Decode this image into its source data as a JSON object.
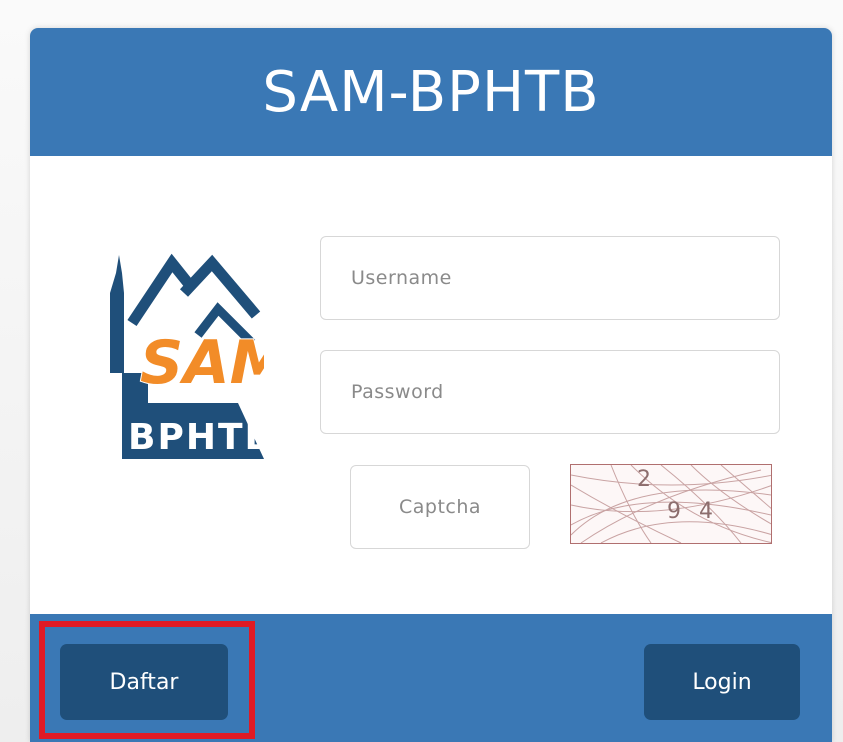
{
  "header": {
    "title": "SAM-BPHTB"
  },
  "logo": {
    "sam_text": "SAM",
    "bphtb_text": "BPHTB"
  },
  "form": {
    "username_placeholder": "Username",
    "username_value": "",
    "password_placeholder": "Password",
    "password_value": "",
    "captcha_placeholder": "Captcha",
    "captcha_value": "",
    "captcha_image_digits": [
      "2",
      "9",
      "4"
    ]
  },
  "footer": {
    "register_label": "Daftar",
    "login_label": "Login"
  },
  "colors": {
    "primary_blue": "#3a78b5",
    "button_dark_blue": "#1f4f7a",
    "logo_orange": "#f28c28",
    "logo_navy": "#1f4f7a",
    "highlight_red": "#e01a25"
  }
}
